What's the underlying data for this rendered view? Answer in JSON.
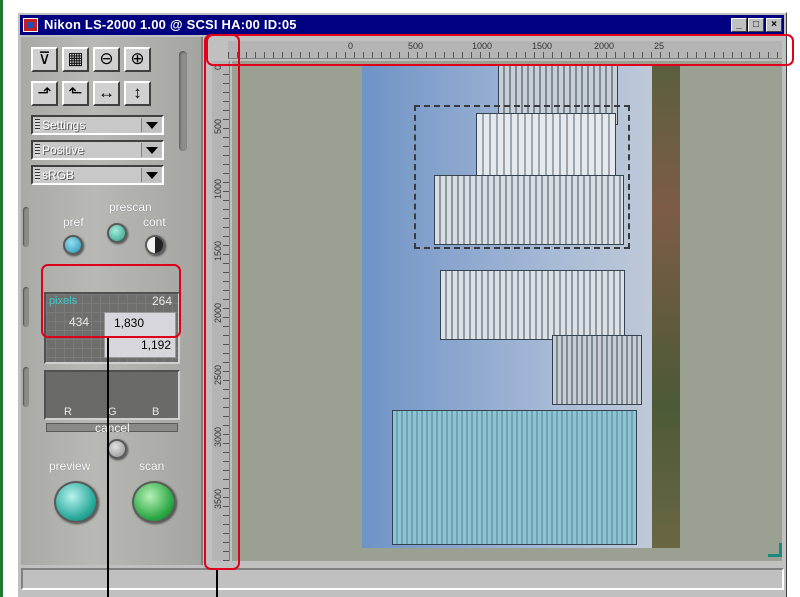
{
  "window": {
    "title": "Nikon LS-2000 1.00 @ SCSI HA:00 ID:05",
    "controls": {
      "minimize": "_",
      "maximize": "□",
      "close": "×"
    }
  },
  "toolbar": {
    "icons": [
      "scan-tray-icon",
      "checker-pattern-icon",
      "zoom-out-icon",
      "zoom-in-icon",
      "rotate-right-icon",
      "rotate-left-icon",
      "flip-horizontal-icon",
      "flip-vertical-icon"
    ],
    "glyphs": [
      "⊽",
      "▦",
      "⊖",
      "⊕",
      "⬏",
      "⬑",
      "↔",
      "↕"
    ]
  },
  "dropdowns": {
    "settings": "Settings",
    "film_type": "Positive",
    "color_space": "sRGB"
  },
  "prescan": {
    "heading": "prescan",
    "pref_label": "pref",
    "cont_label": "cont"
  },
  "pixels_display": {
    "label": "pixels",
    "top_value": "264",
    "left_value": "434",
    "width_value": "1,830",
    "height_value": "1,192"
  },
  "histogram": {
    "channels": [
      "R",
      "G",
      "B"
    ]
  },
  "actions": {
    "cancel_label": "cancel",
    "preview_label": "preview",
    "scan_label": "scan"
  },
  "ruler": {
    "h_labels": [
      "0",
      "500",
      "1000",
      "1500",
      "2000",
      "25"
    ],
    "v_labels": [
      "0",
      "500",
      "1000",
      "1500",
      "2000",
      "2500",
      "3000",
      "3500"
    ]
  },
  "colors": {
    "titlebar": "#000080",
    "annotation": "#e0001b",
    "pref_button": "#3aa3c0",
    "preview_button": "#2bb3a5",
    "scan_button": "#2bb04a"
  }
}
